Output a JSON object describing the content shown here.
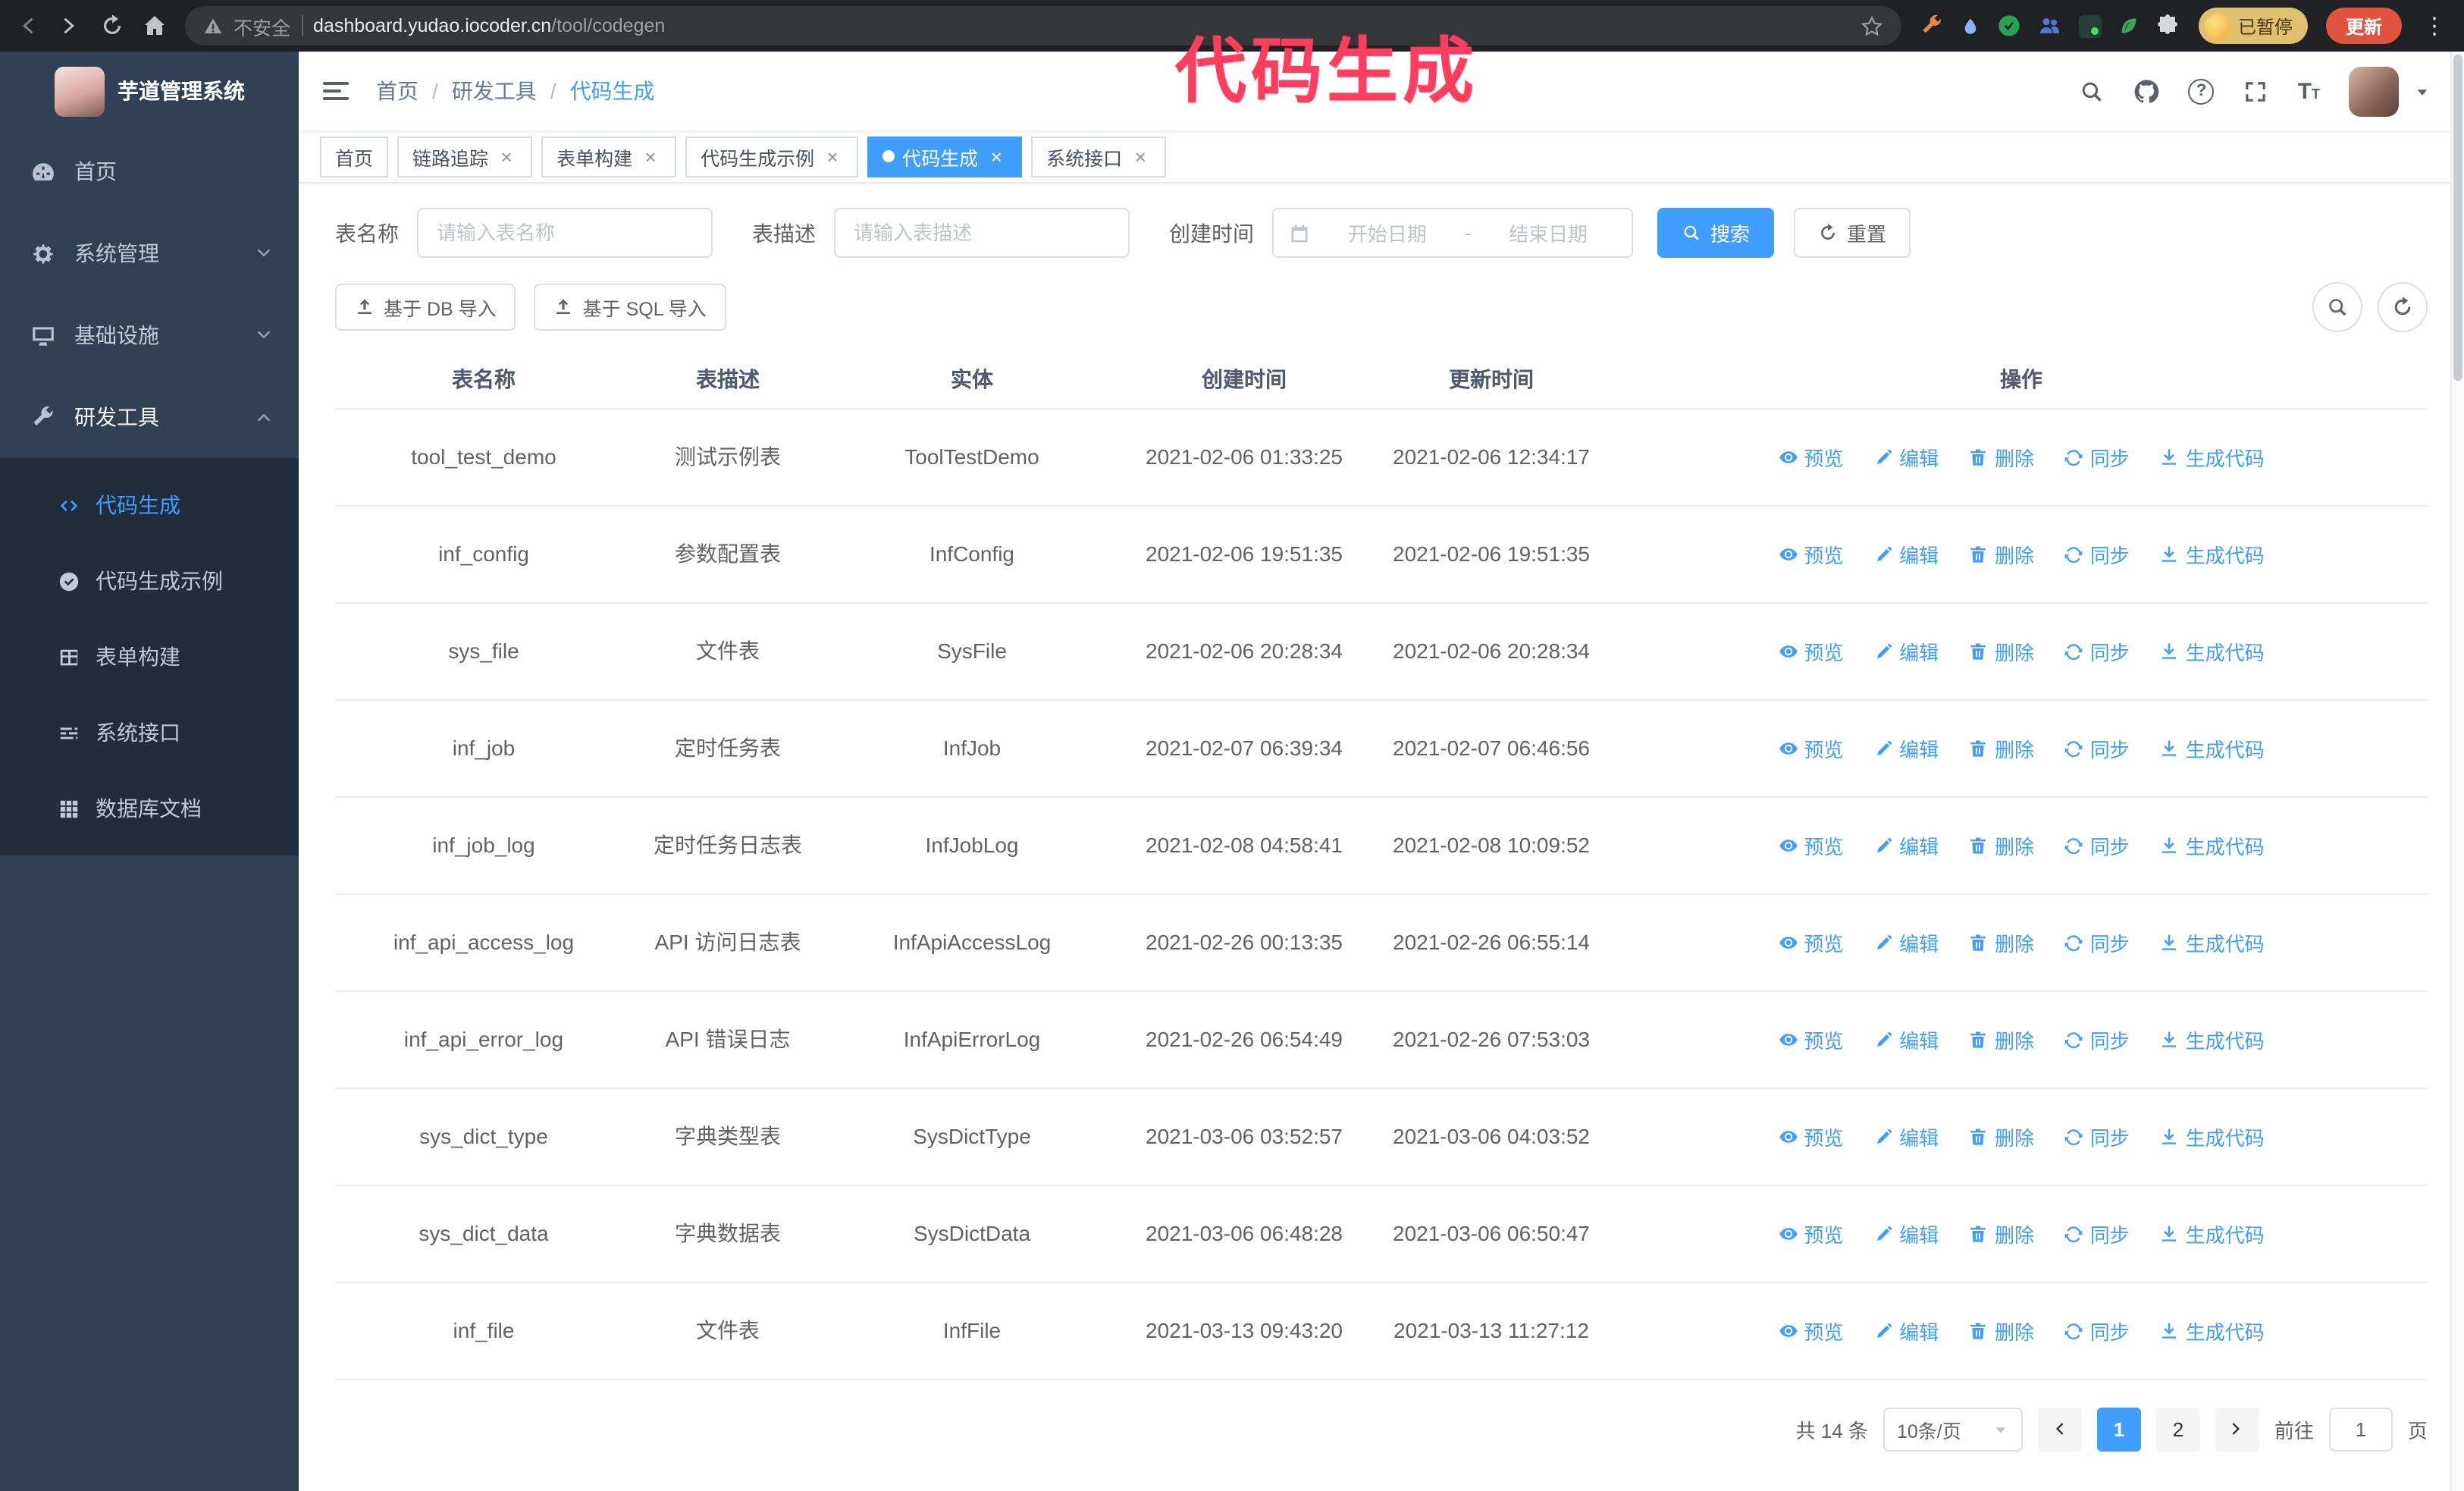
{
  "browser": {
    "security_label": "不安全",
    "url_host": "dashboard.yudao.iocoder.cn",
    "url_path": "/tool/codegen",
    "paused_badge": "已暂停",
    "update_button": "更新"
  },
  "annotation": {
    "text": "代码生成",
    "color": "#fb3d5e"
  },
  "colors": {
    "accent": "#409eff",
    "sidebar_bg": "#304156",
    "submenu_bg": "#1f2d3d",
    "update_button": "#e0533d",
    "annotation": "#fb3d5e"
  },
  "sidebar": {
    "logo_title": "芋道管理系统",
    "items": [
      {
        "label": "首页"
      },
      {
        "label": "系统管理"
      },
      {
        "label": "基础设施"
      },
      {
        "label": "研发工具"
      }
    ],
    "sub_items": [
      {
        "label": "代码生成",
        "active": true
      },
      {
        "label": "代码生成示例"
      },
      {
        "label": "表单构建"
      },
      {
        "label": "系统接口"
      },
      {
        "label": "数据库文档"
      }
    ]
  },
  "breadcrumb": {
    "items": [
      "首页",
      "研发工具",
      "代码生成"
    ],
    "separator": "/"
  },
  "tabs": [
    {
      "label": "首页",
      "closable": false,
      "active": false
    },
    {
      "label": "链路追踪",
      "closable": true,
      "active": false
    },
    {
      "label": "表单构建",
      "closable": true,
      "active": false
    },
    {
      "label": "代码生成示例",
      "closable": true,
      "active": false
    },
    {
      "label": "代码生成",
      "closable": true,
      "active": true
    },
    {
      "label": "系统接口",
      "closable": true,
      "active": false
    }
  ],
  "filters": {
    "table_name_label": "表名称",
    "table_name_placeholder": "请输入表名称",
    "table_desc_label": "表描述",
    "table_desc_placeholder": "请输入表描述",
    "create_time_label": "创建时间",
    "date_start_placeholder": "开始日期",
    "date_separator": "-",
    "date_end_placeholder": "结束日期",
    "search_button": "搜索",
    "reset_button": "重置"
  },
  "toolbar": {
    "import_db": "基于 DB 导入",
    "import_sql": "基于 SQL 导入"
  },
  "table": {
    "columns": [
      "表名称",
      "表描述",
      "实体",
      "创建时间",
      "更新时间",
      "操作"
    ],
    "actions": [
      "预览",
      "编辑",
      "删除",
      "同步",
      "生成代码"
    ],
    "rows": [
      {
        "name": "tool_test_demo",
        "desc": "测试示例表",
        "entity": "ToolTestDemo",
        "created": "2021-02-06 01:33:25",
        "updated": "2021-02-06 12:34:17"
      },
      {
        "name": "inf_config",
        "desc": "参数配置表",
        "entity": "InfConfig",
        "created": "2021-02-06 19:51:35",
        "updated": "2021-02-06 19:51:35"
      },
      {
        "name": "sys_file",
        "desc": "文件表",
        "entity": "SysFile",
        "created": "2021-02-06 20:28:34",
        "updated": "2021-02-06 20:28:34"
      },
      {
        "name": "inf_job",
        "desc": "定时任务表",
        "entity": "InfJob",
        "created": "2021-02-07 06:39:34",
        "updated": "2021-02-07 06:46:56"
      },
      {
        "name": "inf_job_log",
        "desc": "定时任务日志表",
        "entity": "InfJobLog",
        "created": "2021-02-08 04:58:41",
        "updated": "2021-02-08 10:09:52"
      },
      {
        "name": "inf_api_access_log",
        "desc": "API 访问日志表",
        "entity": "InfApiAccessLog",
        "created": "2021-02-26 00:13:35",
        "updated": "2021-02-26 06:55:14"
      },
      {
        "name": "inf_api_error_log",
        "desc": "API 错误日志",
        "entity": "InfApiErrorLog",
        "created": "2021-02-26 06:54:49",
        "updated": "2021-02-26 07:53:03"
      },
      {
        "name": "sys_dict_type",
        "desc": "字典类型表",
        "entity": "SysDictType",
        "created": "2021-03-06 03:52:57",
        "updated": "2021-03-06 04:03:52"
      },
      {
        "name": "sys_dict_data",
        "desc": "字典数据表",
        "entity": "SysDictData",
        "created": "2021-03-06 06:48:28",
        "updated": "2021-03-06 06:50:47"
      },
      {
        "name": "inf_file",
        "desc": "文件表",
        "entity": "InfFile",
        "created": "2021-03-13 09:43:20",
        "updated": "2021-03-13 11:27:12"
      }
    ]
  },
  "pagination": {
    "total_text": "共 14 条",
    "page_size": "10条/页",
    "pages": [
      "1",
      "2"
    ],
    "active_page": "1",
    "goto_label": "前往",
    "goto_value": "1",
    "goto_suffix": "页"
  }
}
